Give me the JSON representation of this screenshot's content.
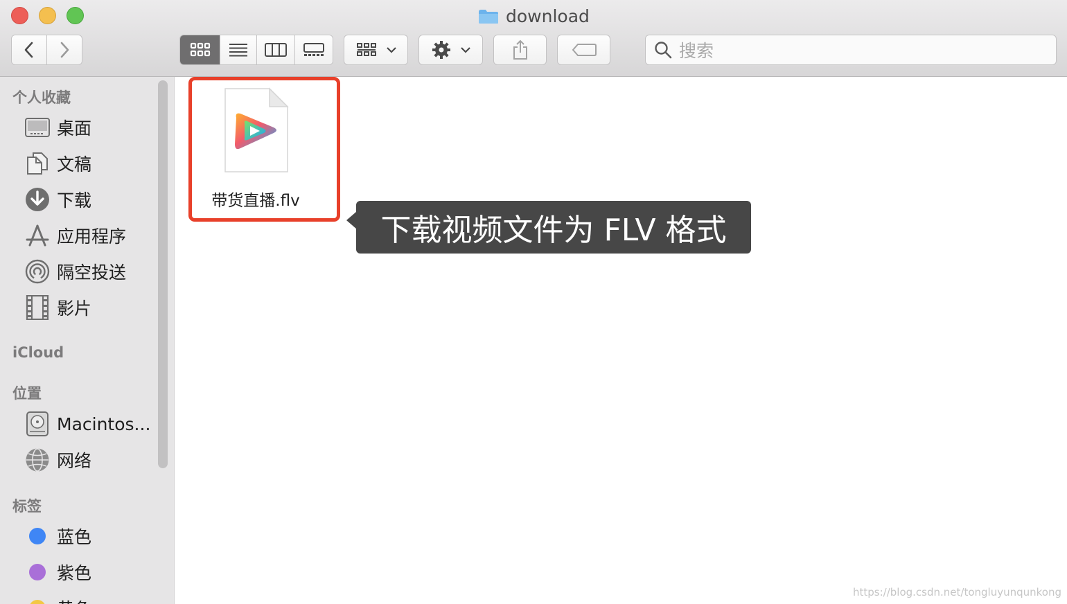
{
  "window": {
    "title": "download"
  },
  "toolbar": {
    "search_placeholder": "搜索"
  },
  "sidebar": {
    "favorites_header": "个人收藏",
    "favorites": [
      {
        "label": "桌面",
        "icon": "desktop-icon"
      },
      {
        "label": "文稿",
        "icon": "documents-icon"
      },
      {
        "label": "下载",
        "icon": "downloads-icon"
      },
      {
        "label": "应用程序",
        "icon": "applications-icon"
      },
      {
        "label": "隔空投送",
        "icon": "airdrop-icon"
      },
      {
        "label": "影片",
        "icon": "movies-icon"
      }
    ],
    "icloud_header": "iCloud",
    "locations_header": "位置",
    "locations": [
      {
        "label": "Macintos...",
        "icon": "harddisk-icon"
      },
      {
        "label": "网络",
        "icon": "network-icon"
      }
    ],
    "tags_header": "标签",
    "tags": [
      {
        "label": "蓝色",
        "color": "#3f86f5"
      },
      {
        "label": "紫色",
        "color": "#a96fd8"
      },
      {
        "label": "黄色",
        "color": "#f3c844"
      }
    ]
  },
  "content": {
    "file": {
      "name": "带货直播.flv",
      "icon": "video-player-file-icon"
    },
    "callout": "下载视频文件为 FLV 格式"
  },
  "watermark": "https://blog.csdn.net/tongluyunqunkong",
  "colors": {
    "highlight": "#e8402a",
    "callout_bg": "#474747",
    "titlebar": "#e3e2e3"
  }
}
